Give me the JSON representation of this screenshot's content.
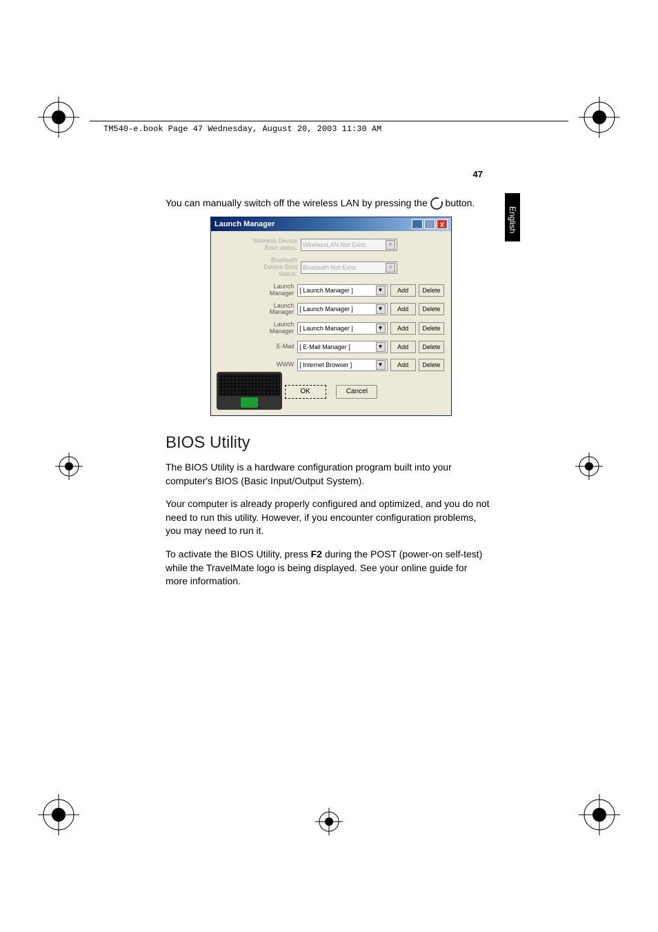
{
  "header": "TM540-e.book  Page 47  Wednesday, August 20, 2003  11:30 AM",
  "page_number": "47",
  "side_tab": "English",
  "intro_1": "You can manually switch off the wireless LAN by pressing the ",
  "intro_2": " button.",
  "launch_manager": {
    "title": "Launch Manager",
    "rows": [
      {
        "label": "Wireless Device Boot status:",
        "value": "WirelessLAN Not Exist.",
        "disabled": true,
        "add": false
      },
      {
        "label": "Bluetooth Device Boot status:",
        "value": "Bluetooth Not Exist.",
        "disabled": true,
        "add": false
      },
      {
        "label": "Launch Manager",
        "value": "[  Launch Manager  ]",
        "disabled": false,
        "add": true
      },
      {
        "label": "Launch Manager",
        "value": "[  Launch Manager  ]",
        "disabled": false,
        "add": true
      },
      {
        "label": "Launch Manager",
        "value": "[  Launch Manager  ]",
        "disabled": false,
        "add": true
      },
      {
        "label": "E-Mail",
        "value": "[  E-Mail Manager  ]",
        "disabled": false,
        "add": true
      },
      {
        "label": "WWW",
        "value": "[  Internet Browser  ]",
        "disabled": false,
        "add": true
      }
    ],
    "add_btn": "Add",
    "delete_btn": "Delete",
    "ok": "OK",
    "cancel": "Cancel"
  },
  "bios_heading": "BIOS Utility",
  "p1": "The BIOS Utility is a hardware configuration program built into your computer's BIOS (Basic Input/Output System).",
  "p2": "Your computer is already properly configured and optimized, and you do not need to run this utility. However, if you encounter configuration problems, you may need to run it.",
  "p3a": "To activate the BIOS Utility, press ",
  "p3key": "F2",
  "p3b": " during the POST (power-on self-test) while the TravelMate logo is being displayed. See your online guide for more information."
}
